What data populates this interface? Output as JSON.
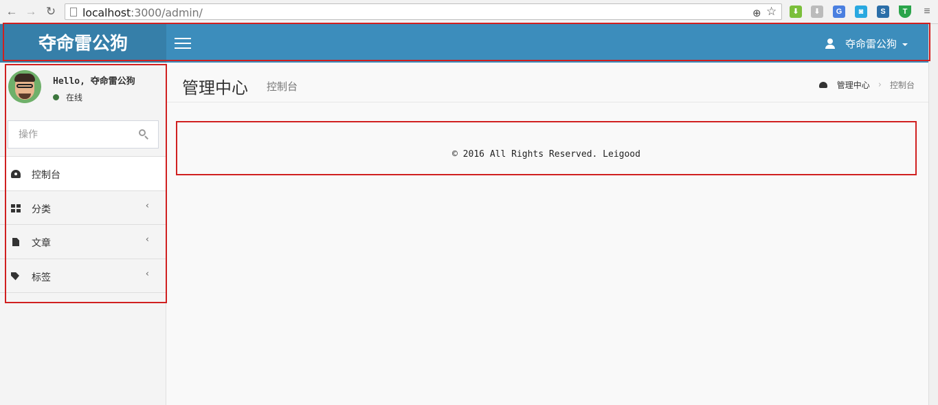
{
  "browser": {
    "url_host": "localhost",
    "url_rest": ":3000/admin/"
  },
  "header": {
    "logo": "夺命雷公狗",
    "user_name": "夺命雷公狗"
  },
  "sidebar": {
    "greeting": "Hello, 夺命雷公狗",
    "status": "在线",
    "search_placeholder": "操作",
    "items": [
      {
        "label": "控制台",
        "icon": "dashboard-icon",
        "has_chevron": false
      },
      {
        "label": "分类",
        "icon": "th-large-icon",
        "has_chevron": true
      },
      {
        "label": "文章",
        "icon": "file-icon",
        "has_chevron": true
      },
      {
        "label": "标签",
        "icon": "tag-icon",
        "has_chevron": true
      }
    ],
    "chevron": "‹"
  },
  "content": {
    "title": "管理中心",
    "subtitle": "控制台",
    "breadcrumb": [
      "管理中心",
      "控制台"
    ],
    "breadcrumb_sep": "›",
    "footer": "© 2016 All Rights Reserved. Leigood"
  },
  "colors": {
    "header": "#3c8dbc",
    "logo_bg": "#367fa9",
    "annotation": "#d01f1f"
  }
}
